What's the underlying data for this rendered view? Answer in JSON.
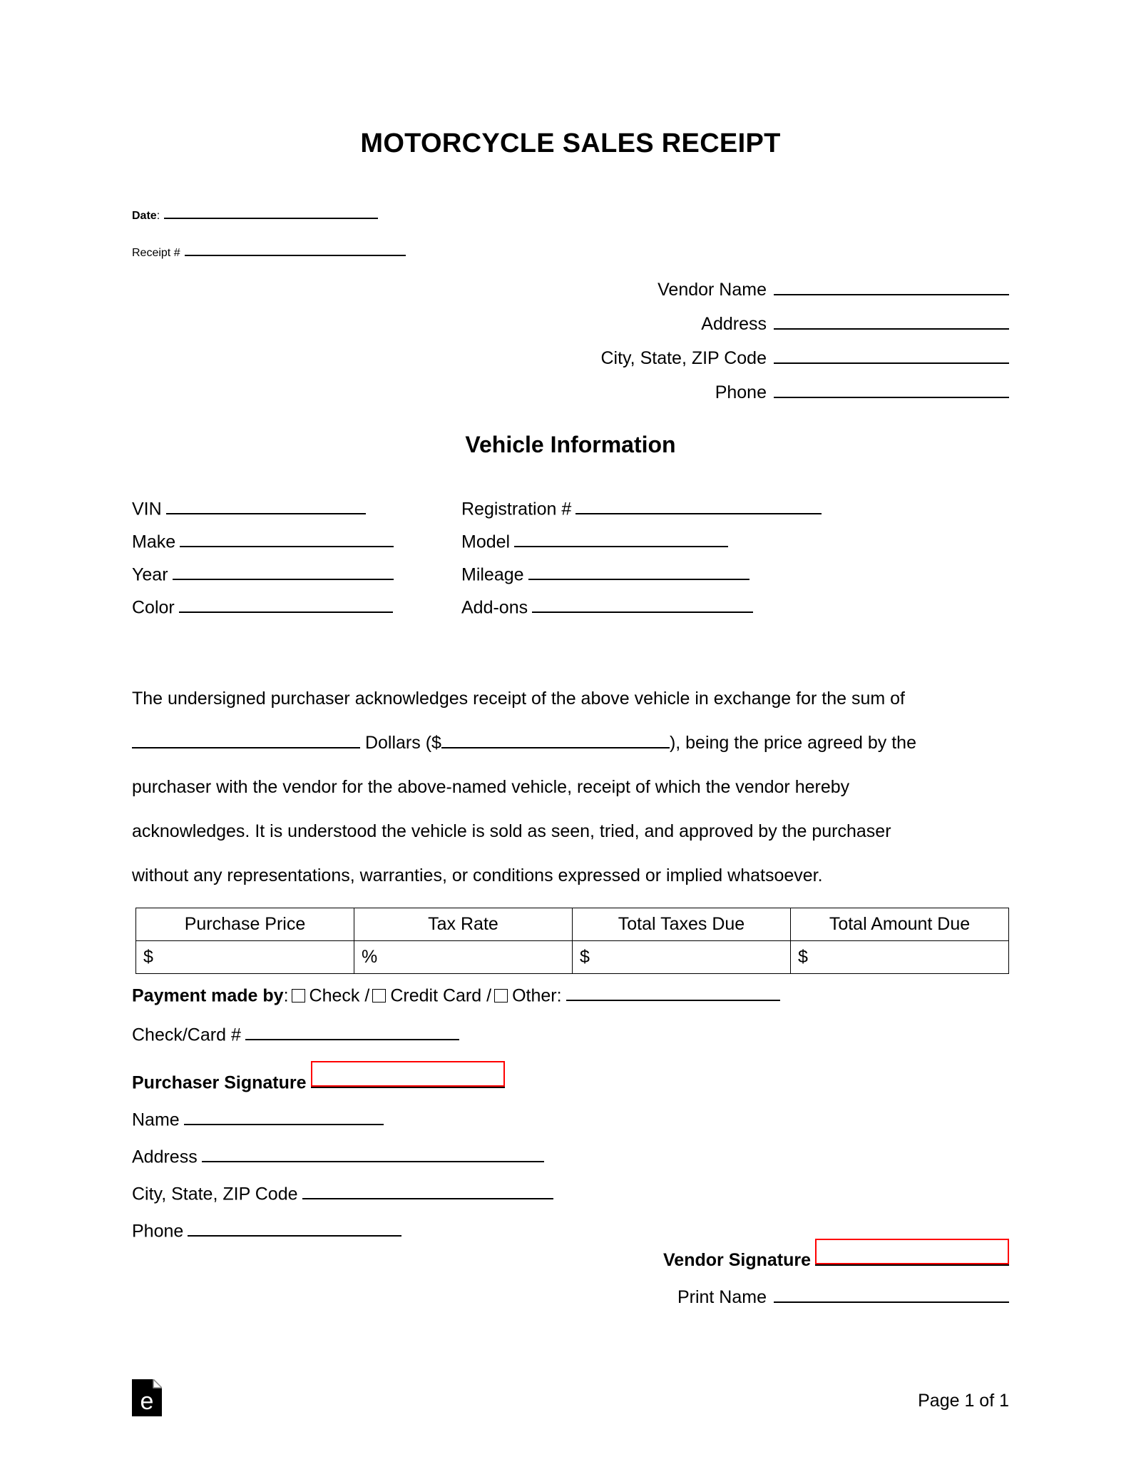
{
  "document": {
    "title": "MOTORCYCLE SALES RECEIPT"
  },
  "header": {
    "date_label": "Date",
    "date_colon": ":",
    "receipt_label": "Receipt #"
  },
  "vendor": {
    "name_label": "Vendor Name",
    "address_label": "Address",
    "city_label": "City, State, ZIP Code",
    "phone_label": "Phone"
  },
  "vehicle": {
    "heading": "Vehicle Information",
    "vin_label": "VIN",
    "registration_label": "Registration #",
    "make_label": "Make",
    "model_label": "Model",
    "year_label": "Year",
    "mileage_label": "Mileage",
    "color_label": "Color",
    "addons_label": "Add-ons"
  },
  "paragraph": {
    "line1": "The undersigned purchaser acknowledges receipt of the above vehicle in exchange for the sum of",
    "dollars_word": "Dollars ($",
    "after_amount": "), being the price agreed by the",
    "line3": "purchaser with the vendor for the above-named vehicle, receipt of which the vendor hereby",
    "line4": "acknowledges. It is understood the vehicle is sold as seen, tried, and approved by the purchaser",
    "line5": "without any representations, warranties, or conditions expressed or implied whatsoever."
  },
  "table": {
    "headers": [
      "Purchase Price",
      "Tax Rate",
      "Total Taxes Due",
      "Total Amount Due"
    ],
    "values": [
      "$",
      "%",
      "$",
      "$"
    ]
  },
  "payment": {
    "label": "Payment made by",
    "colon": ":",
    "check_label": "Check",
    "sep1": "/",
    "credit_label": "Credit Card",
    "sep2": "/",
    "other_label": "Other:",
    "check_card_label": "Check/Card #"
  },
  "purchaser": {
    "signature_label": "Purchaser Signature",
    "name_label": "Name",
    "address_label": "Address",
    "city_label": "City, State, ZIP Code",
    "phone_label": "Phone"
  },
  "vendor_sign": {
    "signature_label": "Vendor Signature",
    "print_name_label": "Print Name"
  },
  "footer": {
    "page_text": "Page 1 of 1",
    "logo_letter": "e"
  },
  "colors": {
    "signature_outline": "#ff0000",
    "text": "#000000",
    "page_background": "#ffffff"
  }
}
